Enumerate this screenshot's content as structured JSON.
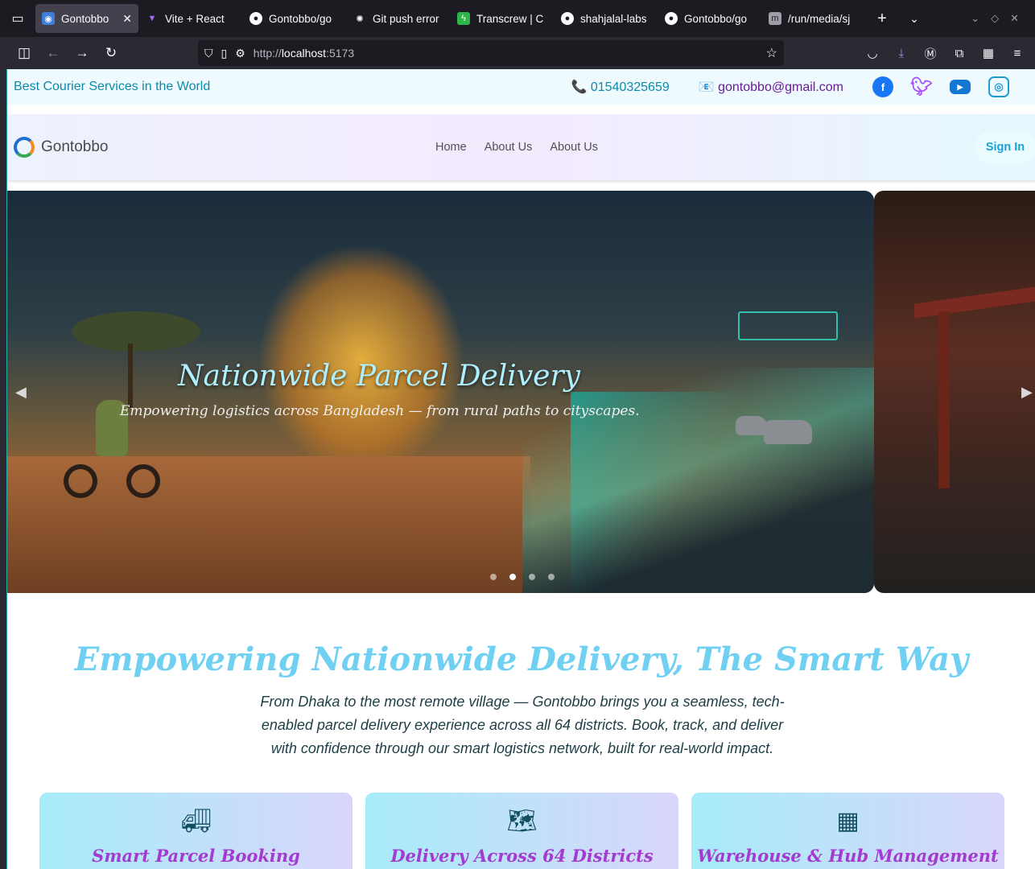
{
  "browser": {
    "tabs": [
      {
        "title": "Gontobbo",
        "icon": "globe-icon",
        "active": true
      },
      {
        "title": "Vite + React",
        "icon": "vite-icon"
      },
      {
        "title": "Gontobbo/go",
        "icon": "github-icon"
      },
      {
        "title": "Git push error",
        "icon": "openai-icon"
      },
      {
        "title": "Transcrew | C",
        "icon": "bolt-icon"
      },
      {
        "title": "shahjalal-labs",
        "icon": "github-icon"
      },
      {
        "title": "Gontobbo/go",
        "icon": "github-icon"
      },
      {
        "title": "/run/media/sj",
        "icon": "book-icon"
      }
    ],
    "url_scheme": "http://",
    "url_host": "localhost",
    "url_port": ":5173"
  },
  "topbar": {
    "tagline": "Best Courier Services in the World",
    "phone": "📞 01540325659",
    "email": "📧 gontobbo@gmail.com",
    "social": [
      "facebook-icon",
      "twitter-icon",
      "youtube-icon",
      "instagram-icon"
    ]
  },
  "header": {
    "brand": "Gontobbo",
    "nav": [
      "Home",
      "About Us",
      "About Us"
    ],
    "signin": "Sign In"
  },
  "hero": {
    "title": "Nationwide Parcel Delivery",
    "subtitle": "Empowering logistics across Bangladesh — from rural paths to cityscapes.",
    "slide_count": 4,
    "active_slide": 2
  },
  "intro": {
    "title": "Empowering Nationwide Delivery, The Smart Way",
    "text": "From Dhaka to the most remote village — Gontobbo brings you a seamless, tech-enabled parcel delivery experience across all 64 districts. Book, track, and deliver with confidence through our smart logistics network, built for real-world impact."
  },
  "features": [
    {
      "title": "Smart Parcel Booking",
      "icon": "truck-icon"
    },
    {
      "title": "Delivery Across 64 Districts",
      "icon": "map-pin-icon"
    },
    {
      "title": "Warehouse & Hub Management",
      "icon": "boxes-icon"
    }
  ],
  "colors": {
    "accent": "#17a2d5",
    "heading": "#6fd0f2",
    "card_title": "#a33bd0"
  }
}
